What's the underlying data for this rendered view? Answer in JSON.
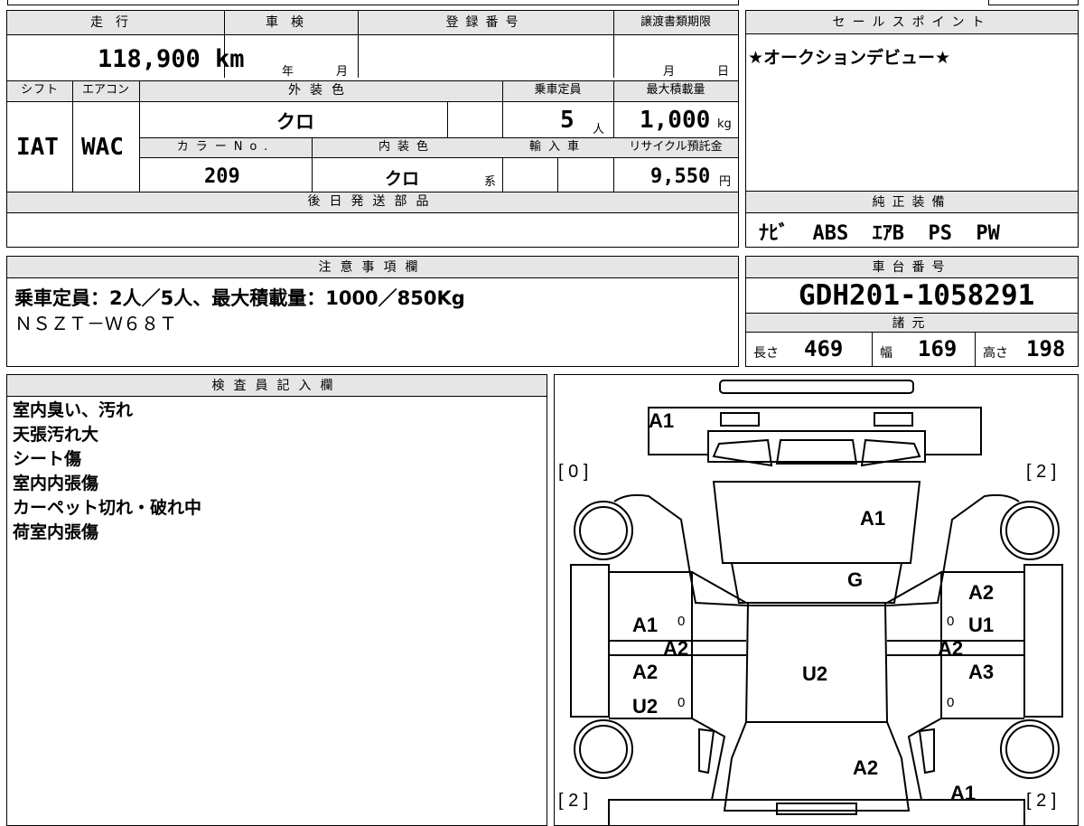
{
  "top": {
    "mileage_label": "走行",
    "mileage_value": "118,900 km",
    "inspection_label": "車検",
    "inspection_year": "年",
    "inspection_month": "月",
    "reg_label": "登録番号",
    "transfer_label": "譲渡書類期限",
    "transfer_month": "月",
    "transfer_day": "日",
    "shift_label": "シフト",
    "aircon_label": "エアコン",
    "exterior_label": "外装色",
    "capacity_label": "乗車定員",
    "load_label": "最大積載量",
    "shift_value": "IAT",
    "aircon_value": "WAC",
    "exterior_value": "クロ",
    "capacity_value": "5",
    "capacity_unit": "人",
    "load_value": "1,000",
    "load_unit": "kg",
    "color_no_label": "カラーNo.",
    "interior_label": "内装色",
    "import_label": "輸入車",
    "recycle_label": "リサイクル預託金",
    "color_no_value": "209",
    "interior_value": "クロ",
    "interior_suffix": "系",
    "recycle_value": "9,550",
    "recycle_unit": "円",
    "later_parts_label": "後日発送部品"
  },
  "sales": {
    "label": "セールスポイント",
    "text": "★オークションデビュー★"
  },
  "equipment": {
    "label": "純正装備",
    "text": "ﾅﾋﾞ  ABS  ｴｱB  PS  PW"
  },
  "notes": {
    "label": "注意事項欄",
    "line1": "乗車定員：2人／5人、最大積載量：1000／850Kg",
    "line2": "ＮＳＺＴ－Ｗ６８Ｔ"
  },
  "chassis": {
    "label": "車台番号",
    "value": "GDH201-1058291",
    "spec_label": "諸元",
    "length_label": "長さ",
    "length_value": "469",
    "width_label": "幅",
    "width_value": "169",
    "height_label": "高さ",
    "height_value": "198"
  },
  "inspector": {
    "label": "検査員記入欄",
    "lines": [
      "室内臭い、汚れ",
      "天張汚れ大",
      "シート傷",
      "室内内張傷",
      "カーペット切れ・破れ中",
      "荷室内張傷"
    ]
  },
  "diagram": {
    "tire_fl": "[ 0 ]",
    "tire_fr": "[ 2 ]",
    "tire_rl": "[ 2 ]",
    "tire_rr": "[ 2 ]",
    "marks": {
      "front_bumper": "A1",
      "hood": "A1",
      "windshield": "G",
      "left_front_door": "A1",
      "left_front_door_num": "0",
      "left_pillar": "A2",
      "left_rear_door": "A2",
      "left_rear_door2": "U2",
      "left_rear_door_num": "0",
      "right_front_door_top": "A2",
      "right_front_door": "U1",
      "right_front_door_num": "0",
      "right_pillar": "A2",
      "right_rear_door": "A3",
      "right_rear_door_num": "0",
      "roof": "U2",
      "rear_glass": "A2",
      "rear_bumper": "A1"
    }
  }
}
